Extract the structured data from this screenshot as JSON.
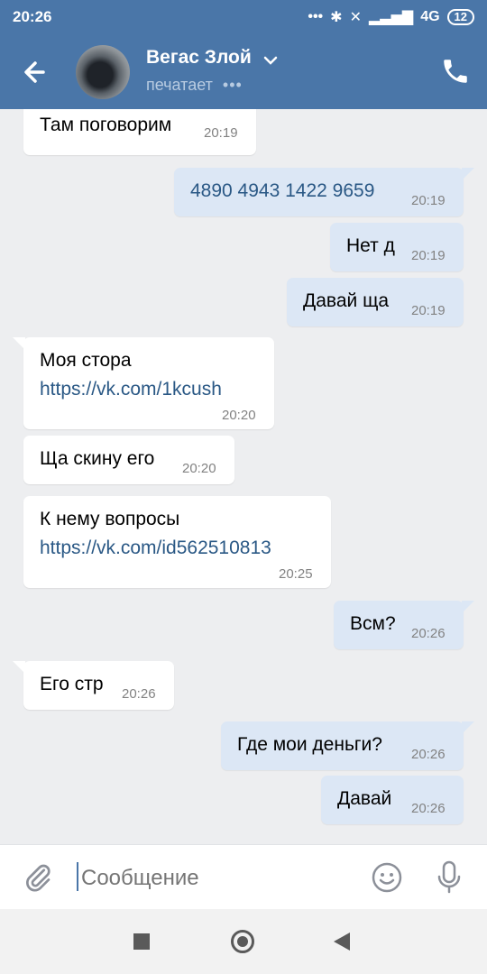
{
  "status_bar": {
    "time": "20:26",
    "network": "4G",
    "battery": "12"
  },
  "header": {
    "contact_name": "Вегас Злой",
    "status": "печатает",
    "typing_indicator": "•••"
  },
  "messages": [
    {
      "direction": "incoming",
      "text": "Там поговорим",
      "time": "20:19"
    },
    {
      "direction": "outgoing",
      "text": "4890 4943 1422 9659",
      "time": "20:19"
    },
    {
      "direction": "outgoing",
      "text": "Нет д",
      "time": "20:19"
    },
    {
      "direction": "outgoing",
      "text": "Давай ща",
      "time": "20:19"
    },
    {
      "direction": "incoming",
      "text": "Моя стора",
      "link": "https://vk.com/1kcush",
      "time": "20:20"
    },
    {
      "direction": "incoming",
      "text": "Ща скину его",
      "time": "20:20"
    },
    {
      "direction": "incoming",
      "text": "К нему вопросы",
      "link": "https://vk.com/id562510813",
      "time": "20:25"
    },
    {
      "direction": "outgoing",
      "text": "Всм?",
      "time": "20:26"
    },
    {
      "direction": "incoming",
      "text": "Его стр",
      "time": "20:26"
    },
    {
      "direction": "outgoing",
      "text": "Где мои деньги?",
      "time": "20:26"
    },
    {
      "direction": "outgoing",
      "text": "Давай",
      "time": "20:26"
    }
  ],
  "composer": {
    "placeholder": "Сообщение"
  },
  "icons": {
    "back": "arrow-left-icon",
    "call": "phone-icon",
    "attach": "paperclip-icon",
    "emoji": "smile-icon",
    "mic": "microphone-icon"
  },
  "colors": {
    "header_bg": "#4a76a8",
    "chat_bg": "#edeef0",
    "outgoing_bubble": "#dce7f5",
    "incoming_bubble": "#ffffff",
    "link": "#2a5885"
  }
}
